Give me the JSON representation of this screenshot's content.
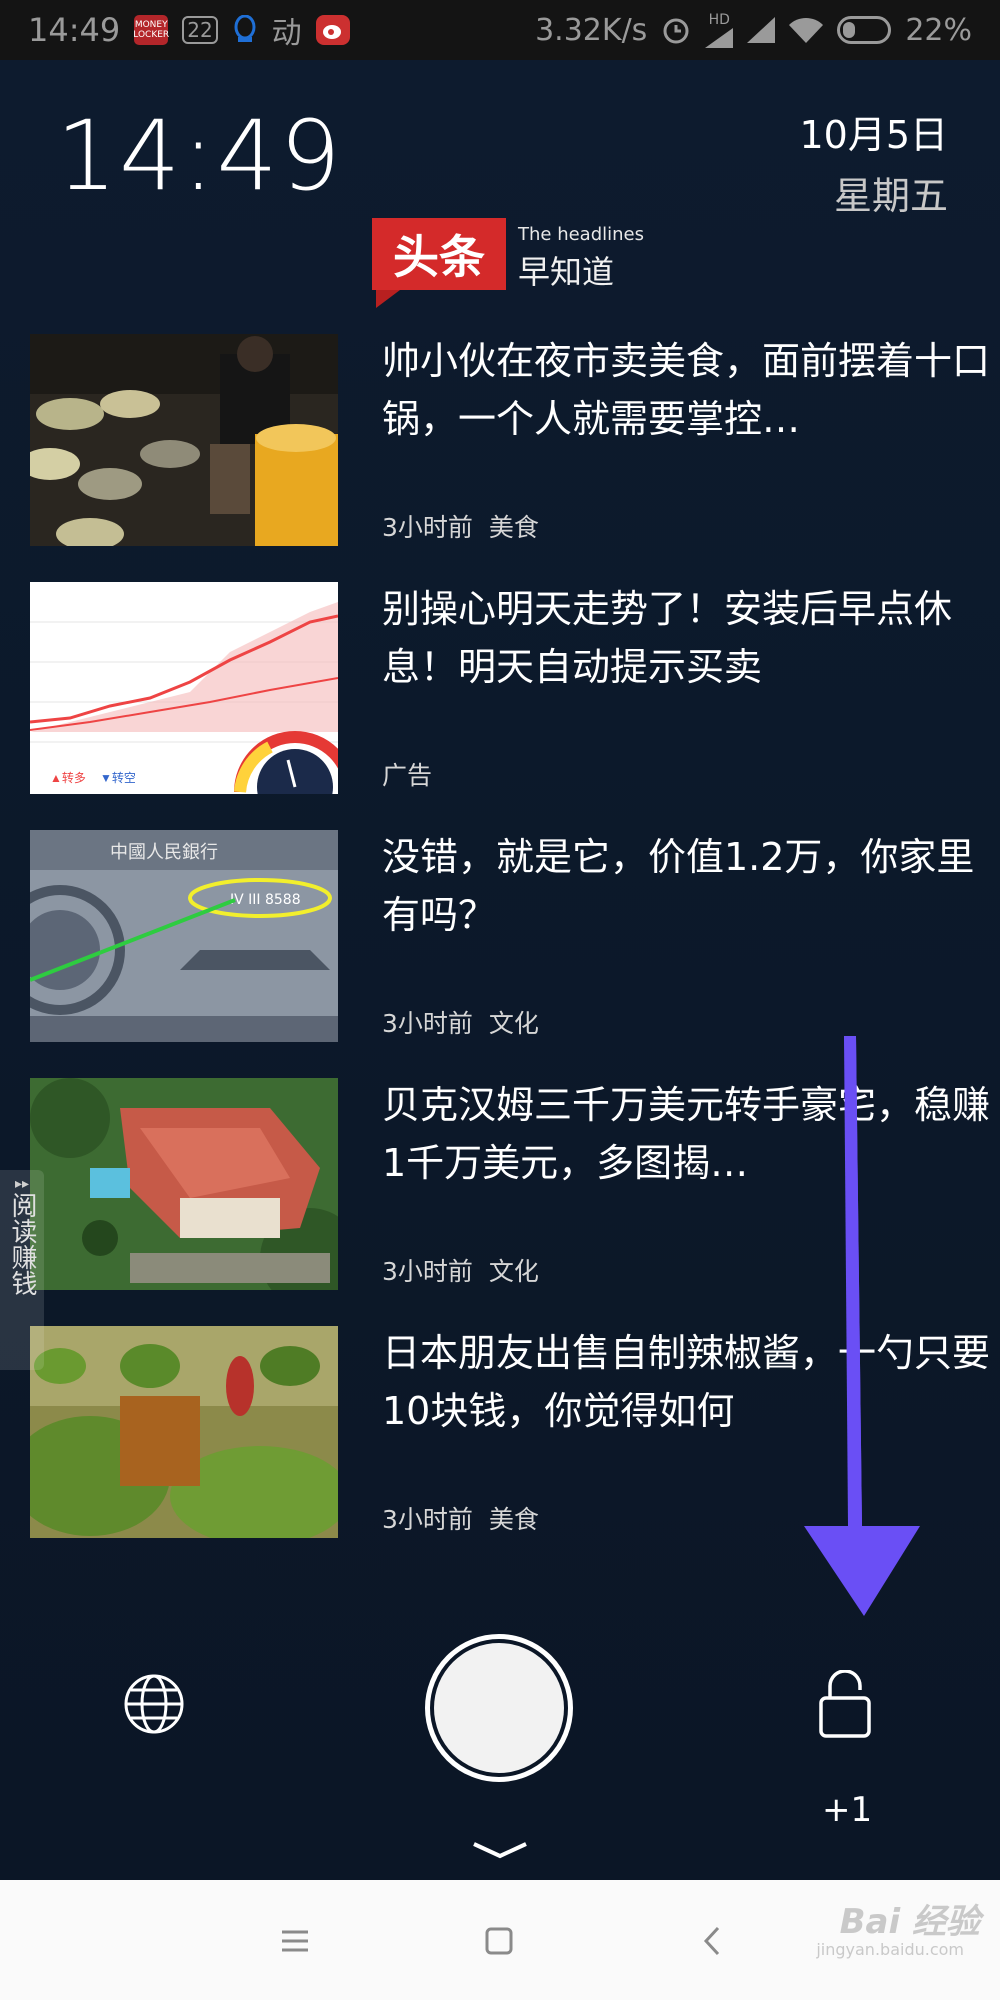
{
  "status_bar": {
    "time": "14:49",
    "notif_badge_count": "22",
    "net_speed": "3.32K/s",
    "network_label": "HD",
    "battery": "22%"
  },
  "lockscreen": {
    "clock": "14:49",
    "date": "10月5日",
    "weekday": "星期五"
  },
  "headlines_logo": {
    "brand": "头条",
    "english": "The headlines",
    "chinese": "早知道"
  },
  "news": [
    {
      "title": "帅小伙在夜市卖美食，面前摆着十口锅，一个人就需要掌控…",
      "time": "3小时前",
      "category": "美食"
    },
    {
      "title": "别操心明天走势了！安装后早点休息！明天自动提示买卖",
      "time": "",
      "category": "广告"
    },
    {
      "title": "没错，就是它，价值1.2万，你家里有吗？",
      "time": "3小时前",
      "category": "文化"
    },
    {
      "title": "贝克汉姆三千万美元转手豪宅，稳赚1千万美元，多图揭…",
      "time": "3小时前",
      "category": "文化"
    },
    {
      "title": "日本朋友出售自制辣椒酱，一勺只要10块钱，你觉得如何",
      "time": "3小时前",
      "category": "美食"
    }
  ],
  "side_tab": {
    "label": "阅读赚钱"
  },
  "bottom": {
    "unlock_badge": "+1"
  },
  "watermark": {
    "text": "Bai 经验",
    "sub": "jingyan.baidu.com"
  },
  "icons": {
    "globe": "globe-icon",
    "unlock": "unlock-icon",
    "shutter": "camera-shutter-icon",
    "menu": "menu-icon",
    "home": "home-icon",
    "back": "back-icon"
  },
  "colors": {
    "background": "#0d1a2c",
    "logo_red": "#d42a2a",
    "arrow": "#6a4ff5"
  }
}
